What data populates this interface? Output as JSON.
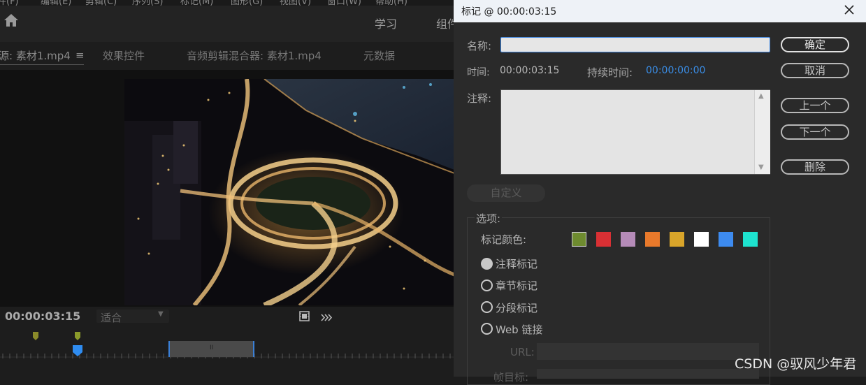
{
  "menu": [
    "件(F)",
    "编辑(E)",
    "剪辑(C)",
    "序列(S)",
    "标记(M)",
    "图形(G)",
    "视图(V)",
    "窗口(W)",
    "帮助(H)"
  ],
  "workspaces": {
    "learn": "学习",
    "assembly": "组件"
  },
  "panel_tabs": {
    "source": "源: 素材1.mp4",
    "source_menu": "≡",
    "effect_controls": "效果控件",
    "audio_mixer": "音频剪辑混合器: 素材1.mp4",
    "metadata": "元数据"
  },
  "monitor": {
    "timecode": "00:00:03:15",
    "fit": "适合",
    "range_label": "II"
  },
  "dialog": {
    "title": "标记 @ 00:00:03:15",
    "name_label": "名称:",
    "name_value": "",
    "time_label": "时间:",
    "time_value": "00:00:03:15",
    "duration_label": "持续时间:",
    "duration_value": "00:00:00:00",
    "notes_label": "注释:",
    "notes_value": "",
    "buttons": {
      "ok": "确定",
      "cancel": "取消",
      "prev": "上一个",
      "next": "下一个",
      "delete": "删除",
      "custom": "自定义"
    },
    "options_label": "选项:",
    "color_label": "标记颜色:",
    "colors": [
      "#6e8b2f",
      "#d93034",
      "#b58bb8",
      "#e8792b",
      "#d9a52a",
      "#ffffff",
      "#3d8bf0",
      "#1ee3cf"
    ],
    "selected_color": "#6e8b2f",
    "marker_types": [
      {
        "label": "注释标记",
        "selected": true
      },
      {
        "label": "章节标记",
        "selected": false
      },
      {
        "label": "分段标记",
        "selected": false
      },
      {
        "label": "Web 链接",
        "selected": false
      }
    ],
    "url_label": "URL:",
    "frame_label": "帧目标:"
  },
  "watermark": "CSDN @驭风少年君",
  "colors": {
    "accent_blue": "#3a8ee8",
    "titlebar": "#eef2f7",
    "dialog_bg": "#2a2a2a"
  }
}
